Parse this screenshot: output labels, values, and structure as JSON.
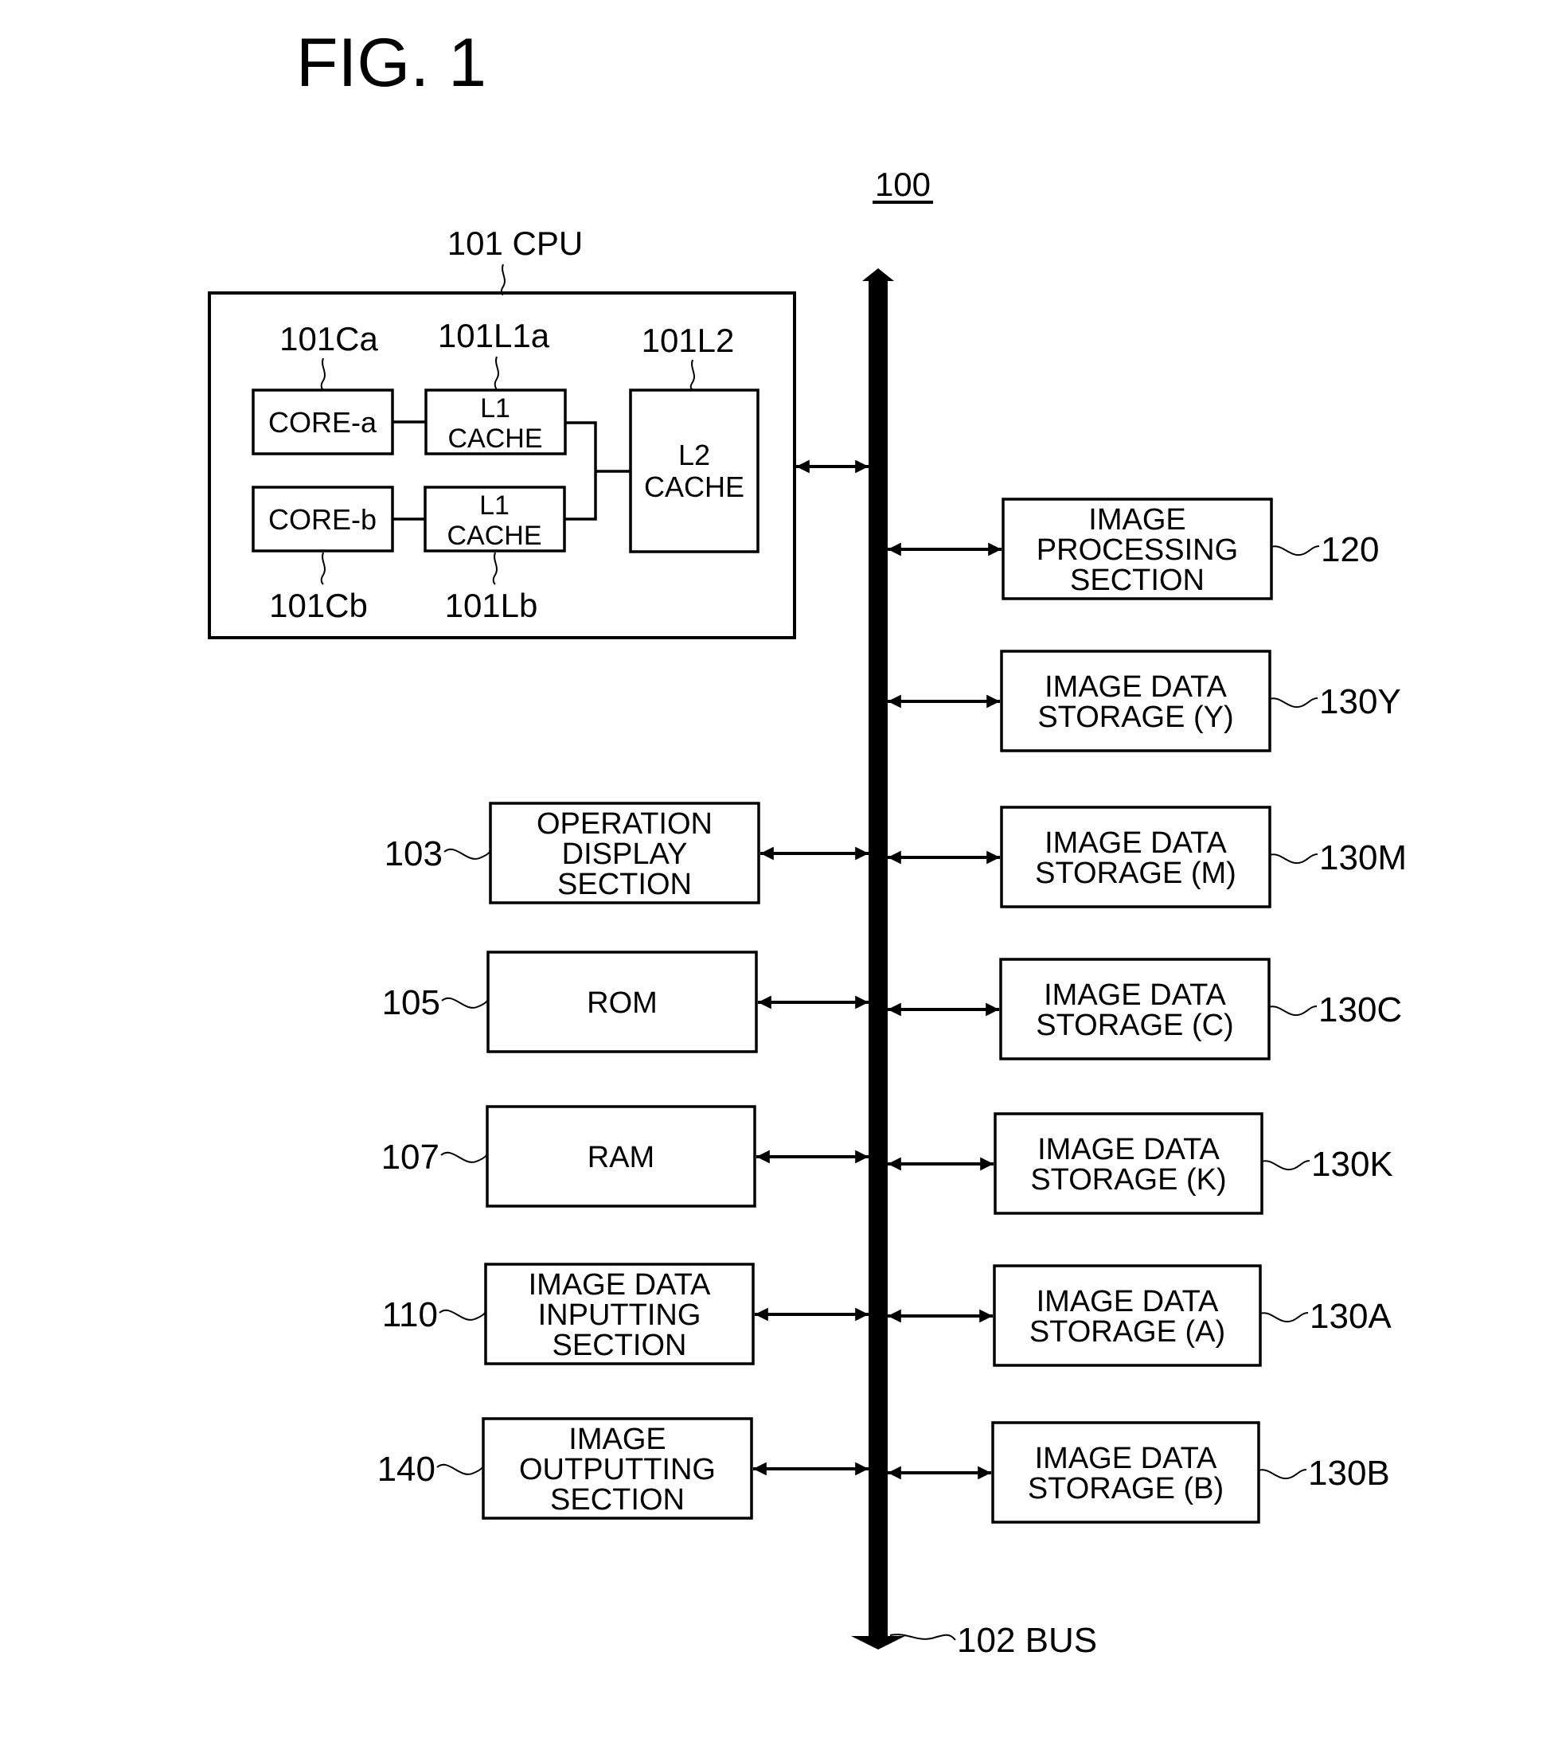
{
  "figure": {
    "title": "FIG. 1",
    "system_ref": "100"
  },
  "cpu": {
    "label": "101 CPU",
    "cores": [
      {
        "ref": "101Ca",
        "name": "CORE-a"
      },
      {
        "ref": "101Cb",
        "name": "CORE-b"
      }
    ],
    "l1_caches": [
      {
        "ref": "101L1a",
        "lines": [
          "L1",
          "CACHE"
        ]
      },
      {
        "ref": "101Lb",
        "lines": [
          "L1",
          "CACHE"
        ]
      }
    ],
    "l2_cache": {
      "ref": "101L2",
      "lines": [
        "L2",
        "CACHE"
      ]
    }
  },
  "bus": {
    "label": "102 BUS"
  },
  "left_blocks": [
    {
      "ref": "103",
      "lines": [
        "OPERATION",
        "DISPLAY",
        "SECTION"
      ]
    },
    {
      "ref": "105",
      "lines": [
        "ROM"
      ]
    },
    {
      "ref": "107",
      "lines": [
        "RAM"
      ]
    },
    {
      "ref": "110",
      "lines": [
        "IMAGE DATA",
        "INPUTTING",
        "SECTION"
      ]
    },
    {
      "ref": "140",
      "lines": [
        "IMAGE",
        "OUTPUTTING",
        "SECTION"
      ]
    }
  ],
  "right_blocks": [
    {
      "ref": "120",
      "lines": [
        "IMAGE",
        "PROCESSING",
        "SECTION"
      ]
    },
    {
      "ref": "130Y",
      "lines": [
        "IMAGE DATA",
        "STORAGE (Y)"
      ]
    },
    {
      "ref": "130M",
      "lines": [
        "IMAGE DATA",
        "STORAGE (M)"
      ]
    },
    {
      "ref": "130C",
      "lines": [
        "IMAGE DATA",
        "STORAGE (C)"
      ]
    },
    {
      "ref": "130K",
      "lines": [
        "IMAGE DATA",
        "STORAGE (K)"
      ]
    },
    {
      "ref": "130A",
      "lines": [
        "IMAGE DATA",
        "STORAGE (A)"
      ]
    },
    {
      "ref": "130B",
      "lines": [
        "IMAGE DATA",
        "STORAGE (B)"
      ]
    }
  ]
}
